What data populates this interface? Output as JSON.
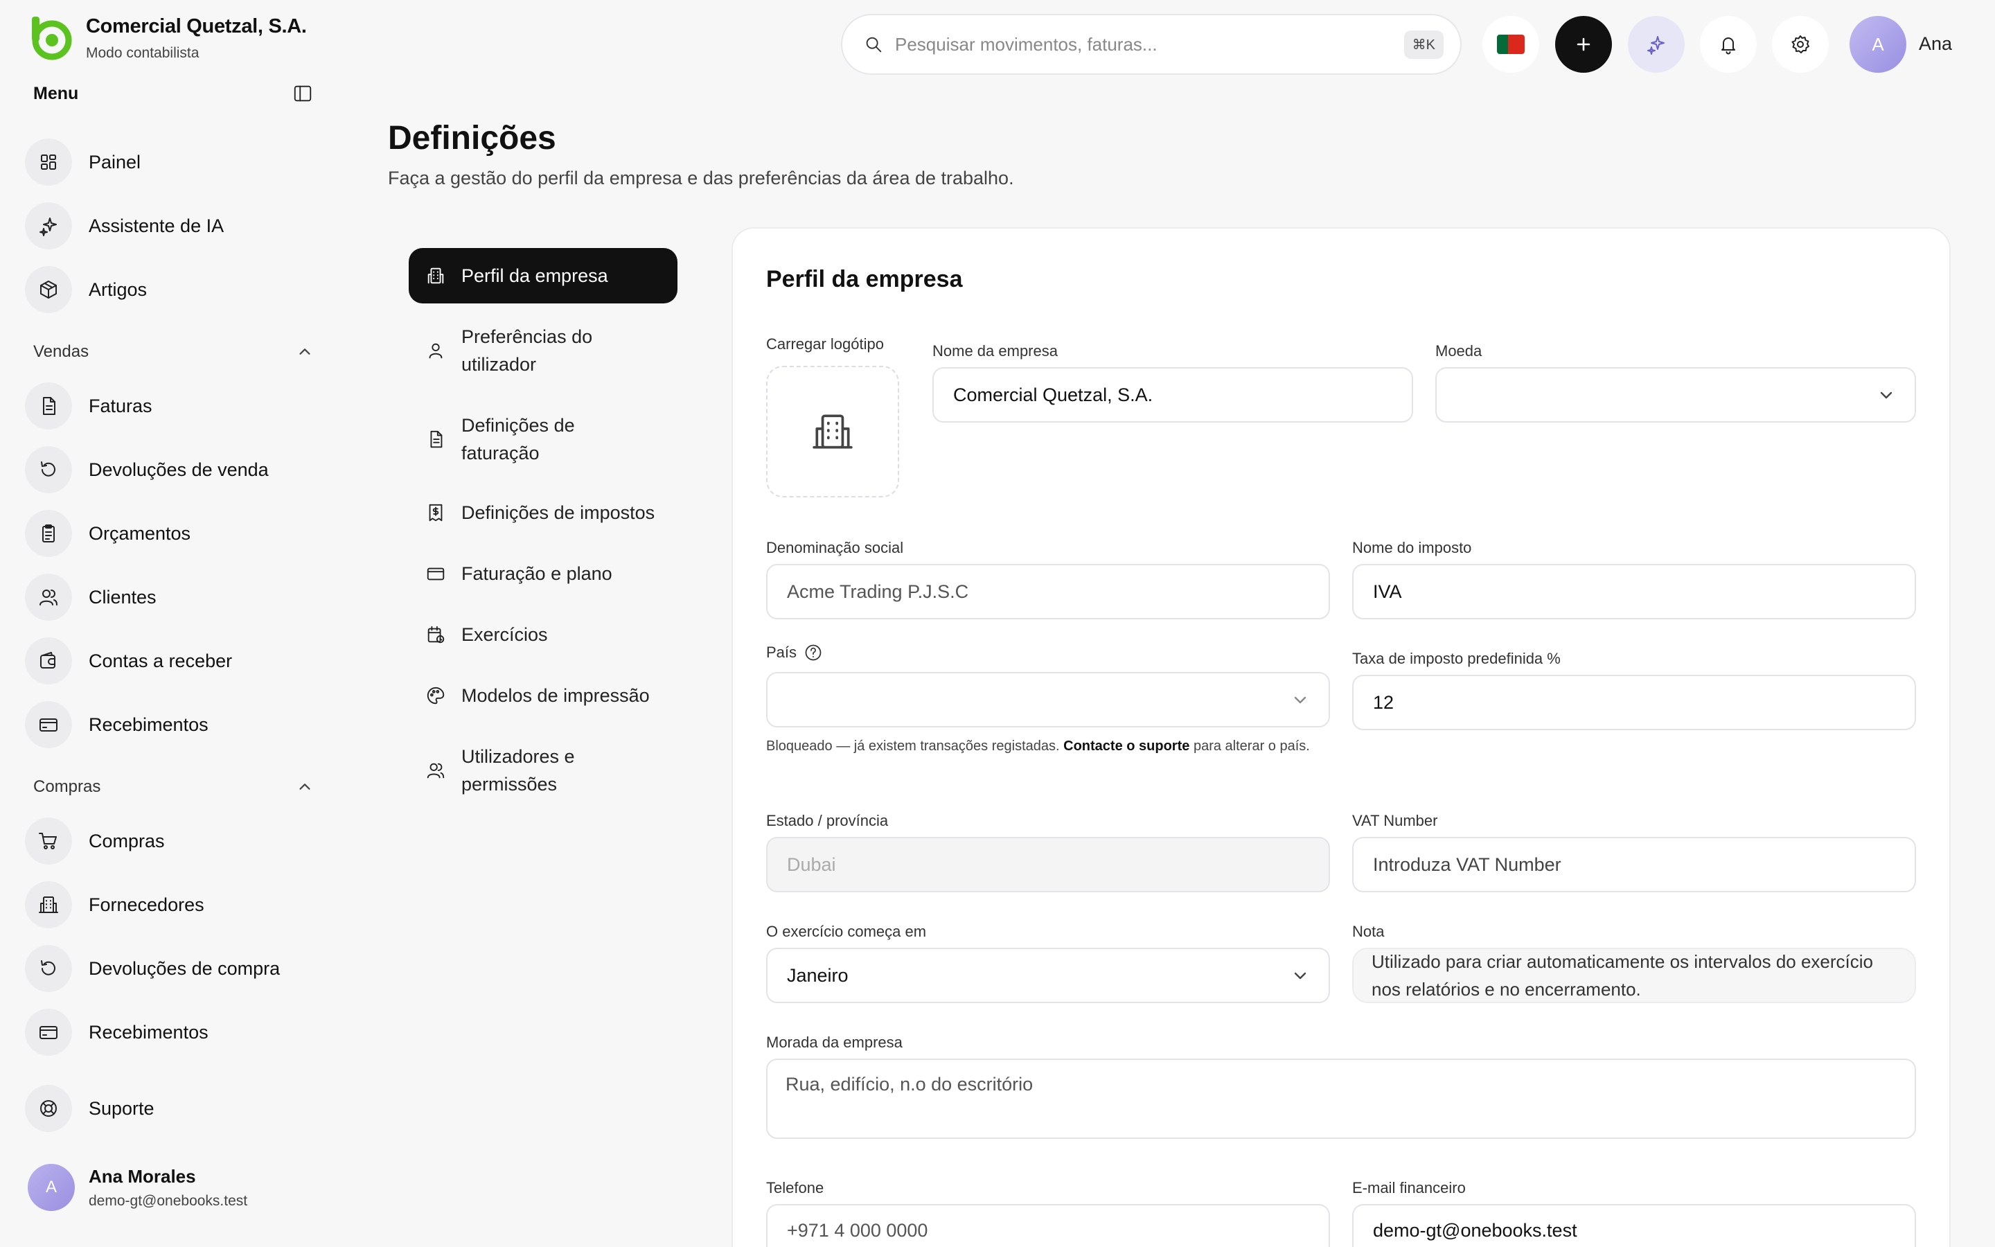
{
  "brand": {
    "name": "Comercial Quetzal, S.A.",
    "mode": "Modo contabilista"
  },
  "sidebar": {
    "menu_title": "Menu",
    "main_items": [
      {
        "label": "Painel",
        "icon": "dashboard-icon"
      },
      {
        "label": "Assistente de IA",
        "icon": "sparkles-icon"
      },
      {
        "label": "Artigos",
        "icon": "package-icon"
      }
    ],
    "sales": {
      "title": "Vendas",
      "items": [
        {
          "label": "Faturas",
          "icon": "file-icon"
        },
        {
          "label": "Devoluções de venda",
          "icon": "rotate-icon"
        },
        {
          "label": "Orçamentos",
          "icon": "clipboard-icon"
        },
        {
          "label": "Clientes",
          "icon": "users-icon"
        },
        {
          "label": "Contas a receber",
          "icon": "wallet-icon"
        },
        {
          "label": "Recebimentos",
          "icon": "card-icon"
        }
      ]
    },
    "purchases": {
      "title": "Compras",
      "items": [
        {
          "label": "Compras",
          "icon": "cart-icon"
        },
        {
          "label": "Fornecedores",
          "icon": "building-icon"
        },
        {
          "label": "Devoluções de compra",
          "icon": "rotate-icon"
        },
        {
          "label": "Recebimentos",
          "icon": "card-icon"
        }
      ]
    },
    "support": {
      "label": "Suporte",
      "icon": "lifebuoy-icon"
    },
    "user": {
      "initial": "A",
      "name": "Ana Morales",
      "email": "demo-gt@onebooks.test"
    }
  },
  "topbar": {
    "search_placeholder": "Pesquisar movimentos, faturas...",
    "shortcut": "⌘K",
    "user_initial": "A",
    "user_name": "Ana"
  },
  "page": {
    "title": "Definições",
    "subtitle": "Faça a gestão do perfil da empresa e das preferências da área de trabalho."
  },
  "settings_nav": [
    {
      "label": "Perfil da empresa",
      "icon": "building-icon",
      "active": true
    },
    {
      "label": "Preferências do utilizador",
      "icon": "user-icon"
    },
    {
      "label": "Definições de faturação",
      "icon": "file-icon"
    },
    {
      "label": "Definições de impostos",
      "icon": "receipt-icon"
    },
    {
      "label": "Faturação e plano",
      "icon": "card-icon"
    },
    {
      "label": "Exercícios",
      "icon": "calendar-icon"
    },
    {
      "label": "Modelos de impressão",
      "icon": "palette-icon"
    },
    {
      "label": "Utilizadores e permissões",
      "icon": "users-icon"
    }
  ],
  "form": {
    "title": "Perfil da empresa",
    "logo_label": "Carregar logótipo",
    "company_name": {
      "label": "Nome da empresa",
      "value": "Comercial Quetzal, S.A."
    },
    "currency": {
      "label": "Moeda",
      "value": ""
    },
    "legal_name": {
      "label": "Denominação social",
      "value": "Acme Trading P.J.S.C"
    },
    "tax_name": {
      "label": "Nome do imposto",
      "value": "IVA"
    },
    "country": {
      "label": "País",
      "value": ""
    },
    "country_hint_pre": "Bloqueado — já existem transações registadas.",
    "country_hint_link": "Contacte o suporte",
    "country_hint_post": "para alterar o país.",
    "default_tax": {
      "label": "Taxa de imposto predefinida %",
      "value": "12"
    },
    "state": {
      "label": "Estado / província",
      "value": "Dubai"
    },
    "vat": {
      "label": "VAT Number",
      "placeholder": "Introduza VAT Number"
    },
    "fiscal_start": {
      "label": "O exercício começa em",
      "value": "Janeiro"
    },
    "note": {
      "label": "Nota",
      "text": "Utilizado para criar automaticamente os intervalos do exercício nos relatórios e no encerramento."
    },
    "address": {
      "label": "Morada da empresa",
      "placeholder": "Rua, edifício, n.o do escritório"
    },
    "phone": {
      "label": "Telefone",
      "value": "+971 4 000 0000"
    },
    "finance_email": {
      "label": "E-mail financeiro",
      "value": "demo-gt@onebooks.test"
    }
  },
  "colors": {
    "accent": "#5cc21f",
    "primary": "#111111",
    "ai_bg": "#e7e6f6",
    "avatar": "#a79de6"
  }
}
